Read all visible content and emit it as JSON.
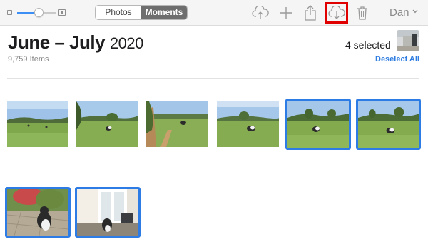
{
  "toolbar": {
    "zoom_level": 0.55,
    "segments": [
      {
        "label": "Photos",
        "active": false
      },
      {
        "label": "Moments",
        "active": true
      }
    ],
    "user": "Dan",
    "icons": [
      "upload-icon",
      "add-icon",
      "share-icon",
      "icloud-download-icon",
      "trash-icon"
    ],
    "highlight_color": "#e00000"
  },
  "header": {
    "title_month": "June – July",
    "title_year": "2020",
    "item_count": "9,759 Items",
    "selected_count": "4 selected",
    "deselect_label": "Deselect All"
  },
  "colors": {
    "accent": "#2d7be4",
    "link": "#2f7de1"
  },
  "photos": [
    {
      "subject": "field-wide",
      "selected": false
    },
    {
      "subject": "field-tree-cat",
      "selected": false
    },
    {
      "subject": "field-fence-cat",
      "selected": false
    },
    {
      "subject": "field-tree-cat",
      "selected": false
    },
    {
      "subject": "field-trees-cat",
      "selected": true
    },
    {
      "subject": "field-trees-cat",
      "selected": true
    },
    {
      "subject": "garden-cat",
      "selected": true
    },
    {
      "subject": "door-cat",
      "selected": true
    }
  ]
}
